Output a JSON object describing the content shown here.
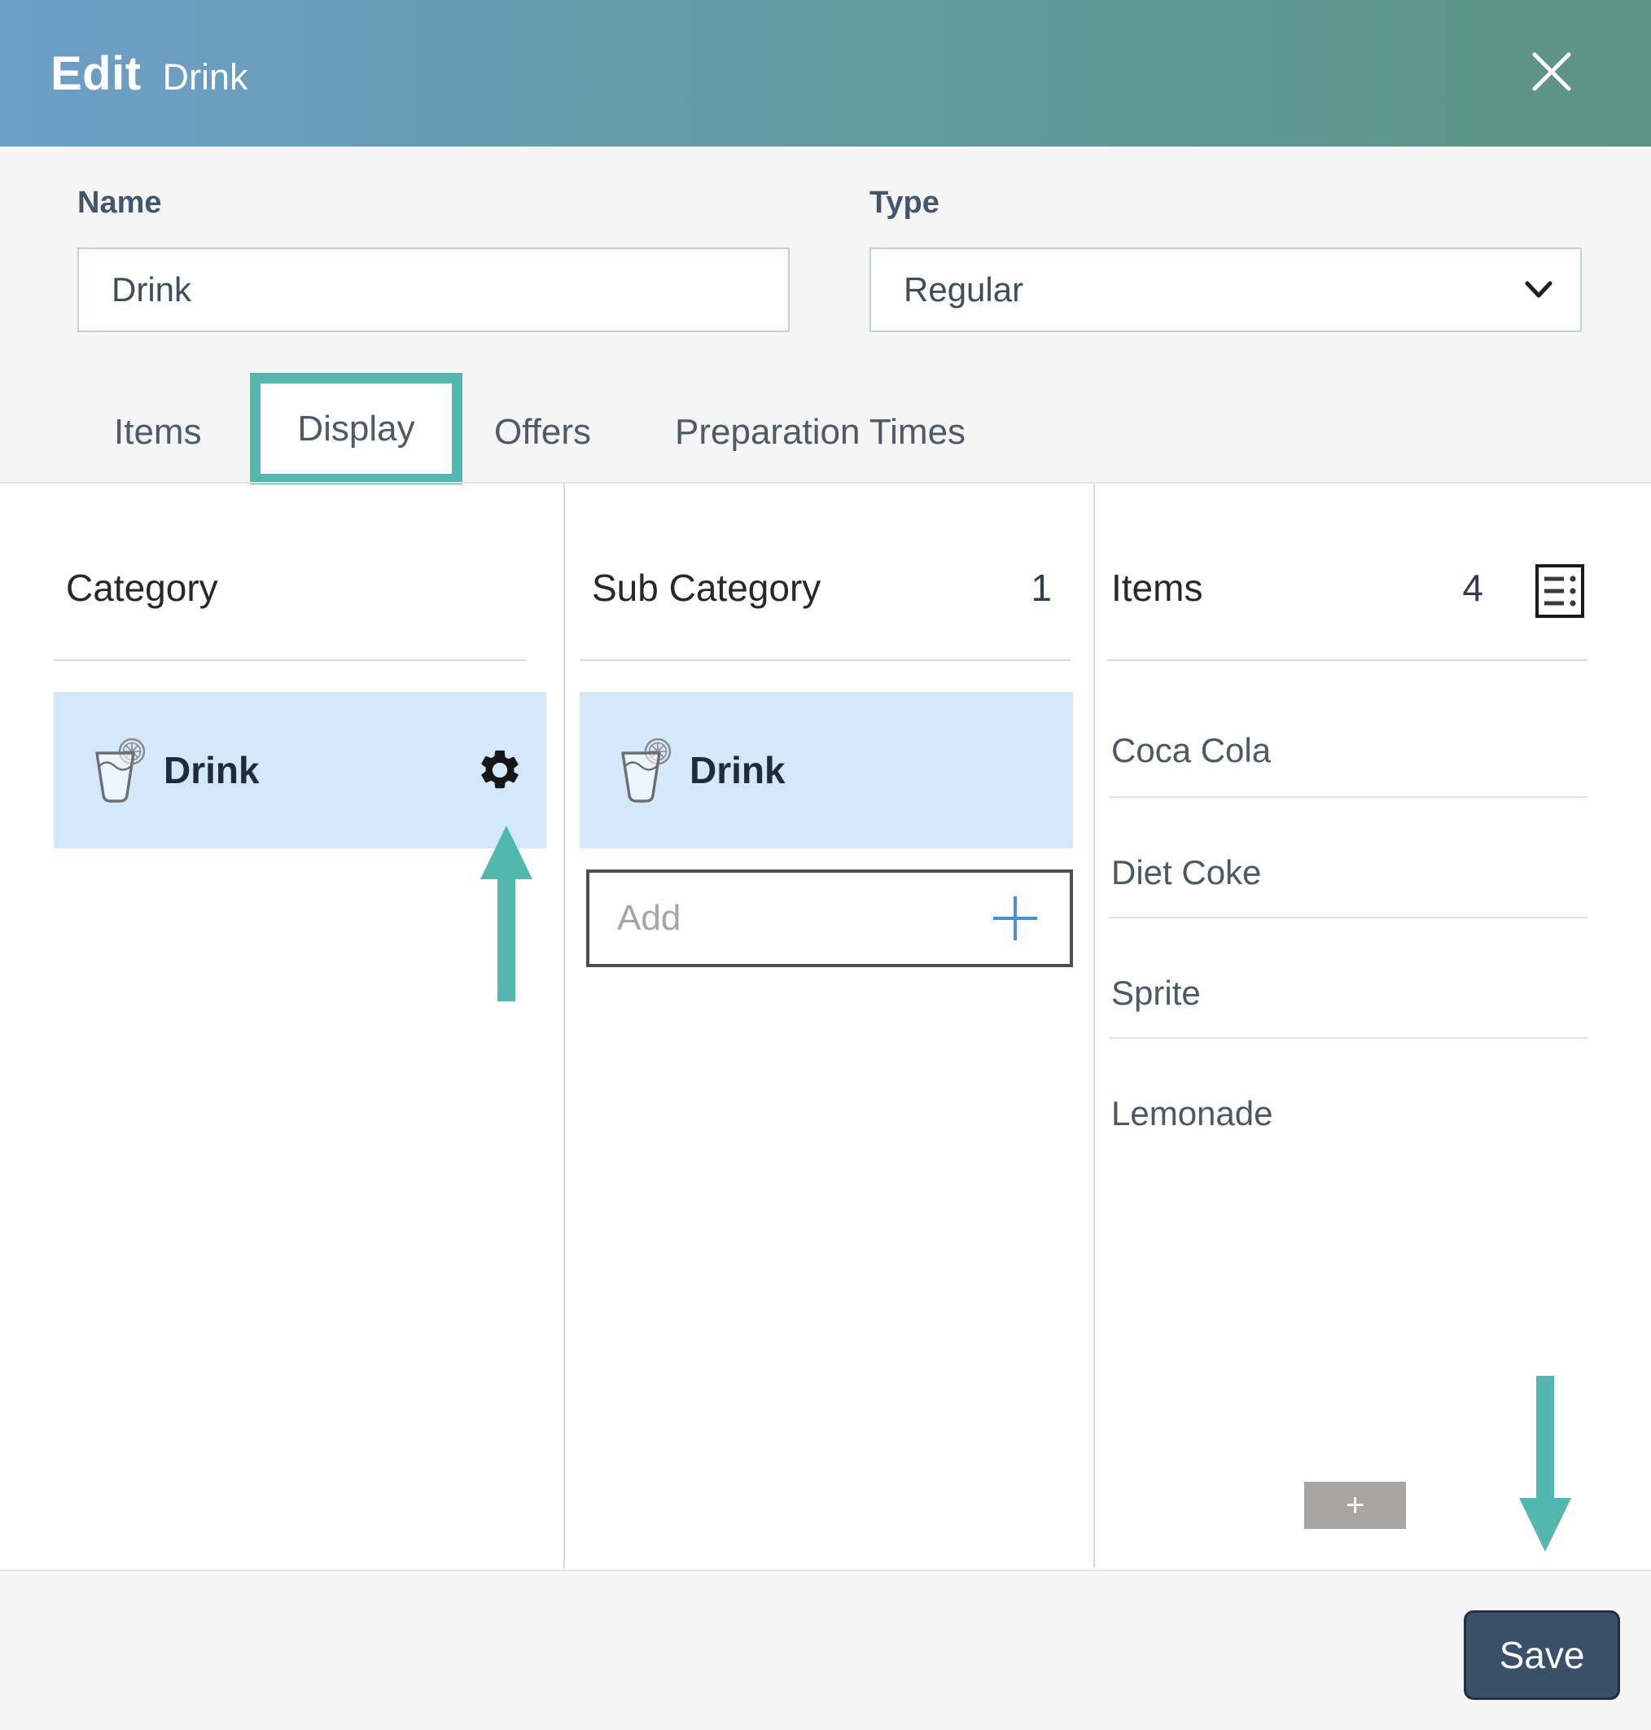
{
  "header": {
    "title_primary": "Edit",
    "title_secondary": "Drink"
  },
  "form": {
    "name_label": "Name",
    "name_value": "Drink",
    "type_label": "Type",
    "type_value": "Regular"
  },
  "tabs": [
    {
      "label": "Items",
      "active": false
    },
    {
      "label": "Display",
      "active": true
    },
    {
      "label": "Offers",
      "active": false
    },
    {
      "label": "Preparation Times",
      "active": false
    }
  ],
  "columns": {
    "category": {
      "title": "Category",
      "rows": [
        {
          "label": "Drink",
          "selected": true
        }
      ]
    },
    "sub_category": {
      "title": "Sub Category",
      "count": "1",
      "rows": [
        {
          "label": "Drink",
          "selected": true
        }
      ],
      "add_placeholder": "Add"
    },
    "items": {
      "title": "Items",
      "count": "4",
      "rows": [
        "Coca Cola",
        "Diet Coke",
        "Sprite",
        "Lemonade"
      ],
      "add_button_label": "+"
    }
  },
  "footer": {
    "save_label": "Save"
  },
  "icons": {
    "close": "close-icon",
    "chevron": "chevron-down-icon",
    "drink": "drink-glass-icon",
    "gear": "gear-icon",
    "list": "list-icon",
    "plus": "plus-icon"
  },
  "colors": {
    "header_gradient_left": "#6d9fc8",
    "header_gradient_right": "#5d9384",
    "accent_teal": "#52b7ae",
    "selected_row_blue": "#d3e8fb",
    "save_button": "#3a5068",
    "section_gray": "#f5f5f6",
    "plus_blue": "#4a90d9"
  }
}
